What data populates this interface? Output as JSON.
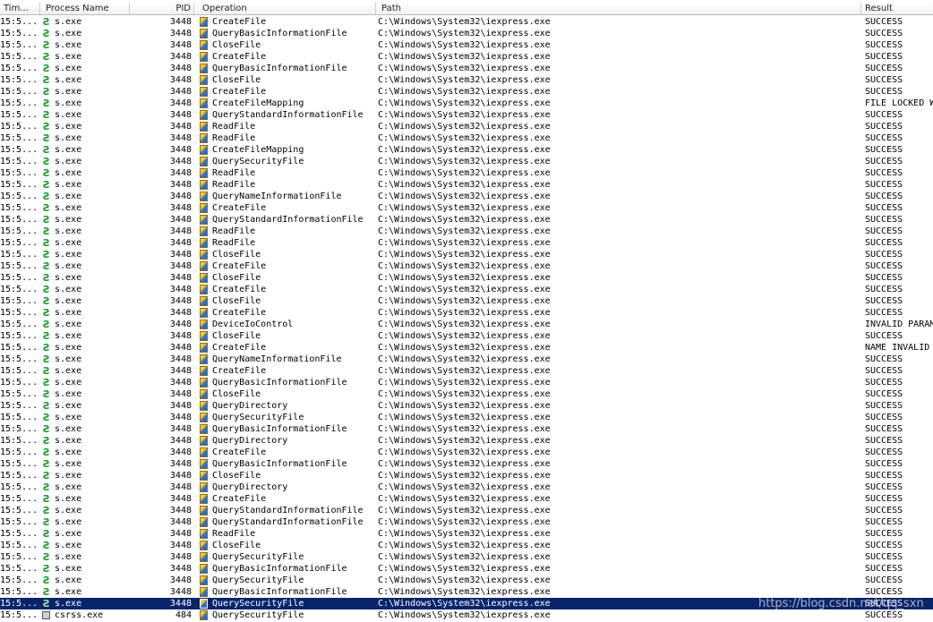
{
  "columns": {
    "time": "Tim...",
    "process": "Process Name",
    "pid": "PID",
    "operation": "Operation",
    "path": "Path",
    "result": "Result"
  },
  "rows": [
    {
      "time": "15:5...",
      "process": "s.exe",
      "pid": "3448",
      "operation": "CreateFile",
      "path": "C:\\Windows\\System32\\iexpress.exe",
      "result": "SUCCESS"
    },
    {
      "time": "15:5...",
      "process": "s.exe",
      "pid": "3448",
      "operation": "QueryBasicInformationFile",
      "path": "C:\\Windows\\System32\\iexpress.exe",
      "result": "SUCCESS"
    },
    {
      "time": "15:5...",
      "process": "s.exe",
      "pid": "3448",
      "operation": "CloseFile",
      "path": "C:\\Windows\\System32\\iexpress.exe",
      "result": "SUCCESS"
    },
    {
      "time": "15:5...",
      "process": "s.exe",
      "pid": "3448",
      "operation": "CreateFile",
      "path": "C:\\Windows\\System32\\iexpress.exe",
      "result": "SUCCESS"
    },
    {
      "time": "15:5...",
      "process": "s.exe",
      "pid": "3448",
      "operation": "QueryBasicInformationFile",
      "path": "C:\\Windows\\System32\\iexpress.exe",
      "result": "SUCCESS"
    },
    {
      "time": "15:5...",
      "process": "s.exe",
      "pid": "3448",
      "operation": "CloseFile",
      "path": "C:\\Windows\\System32\\iexpress.exe",
      "result": "SUCCESS"
    },
    {
      "time": "15:5...",
      "process": "s.exe",
      "pid": "3448",
      "operation": "CreateFile",
      "path": "C:\\Windows\\System32\\iexpress.exe",
      "result": "SUCCESS"
    },
    {
      "time": "15:5...",
      "process": "s.exe",
      "pid": "3448",
      "operation": "CreateFileMapping",
      "path": "C:\\Windows\\System32\\iexpress.exe",
      "result": "FILE LOCKED W"
    },
    {
      "time": "15:5...",
      "process": "s.exe",
      "pid": "3448",
      "operation": "QueryStandardInformationFile",
      "path": "C:\\Windows\\System32\\iexpress.exe",
      "result": "SUCCESS"
    },
    {
      "time": "15:5...",
      "process": "s.exe",
      "pid": "3448",
      "operation": "ReadFile",
      "path": "C:\\Windows\\System32\\iexpress.exe",
      "result": "SUCCESS"
    },
    {
      "time": "15:5...",
      "process": "s.exe",
      "pid": "3448",
      "operation": "ReadFile",
      "path": "C:\\Windows\\System32\\iexpress.exe",
      "result": "SUCCESS"
    },
    {
      "time": "15:5...",
      "process": "s.exe",
      "pid": "3448",
      "operation": "CreateFileMapping",
      "path": "C:\\Windows\\System32\\iexpress.exe",
      "result": "SUCCESS"
    },
    {
      "time": "15:5...",
      "process": "s.exe",
      "pid": "3448",
      "operation": "QuerySecurityFile",
      "path": "C:\\Windows\\System32\\iexpress.exe",
      "result": "SUCCESS"
    },
    {
      "time": "15:5...",
      "process": "s.exe",
      "pid": "3448",
      "operation": "ReadFile",
      "path": "C:\\Windows\\System32\\iexpress.exe",
      "result": "SUCCESS"
    },
    {
      "time": "15:5...",
      "process": "s.exe",
      "pid": "3448",
      "operation": "ReadFile",
      "path": "C:\\Windows\\System32\\iexpress.exe",
      "result": "SUCCESS"
    },
    {
      "time": "15:5...",
      "process": "s.exe",
      "pid": "3448",
      "operation": "QueryNameInformationFile",
      "path": "C:\\Windows\\System32\\iexpress.exe",
      "result": "SUCCESS"
    },
    {
      "time": "15:5...",
      "process": "s.exe",
      "pid": "3448",
      "operation": "CreateFile",
      "path": "C:\\Windows\\System32\\iexpress.exe",
      "result": "SUCCESS"
    },
    {
      "time": "15:5...",
      "process": "s.exe",
      "pid": "3448",
      "operation": "QueryStandardInformationFile",
      "path": "C:\\Windows\\System32\\iexpress.exe",
      "result": "SUCCESS"
    },
    {
      "time": "15:5...",
      "process": "s.exe",
      "pid": "3448",
      "operation": "ReadFile",
      "path": "C:\\Windows\\System32\\iexpress.exe",
      "result": "SUCCESS"
    },
    {
      "time": "15:5...",
      "process": "s.exe",
      "pid": "3448",
      "operation": "ReadFile",
      "path": "C:\\Windows\\System32\\iexpress.exe",
      "result": "SUCCESS"
    },
    {
      "time": "15:5...",
      "process": "s.exe",
      "pid": "3448",
      "operation": "CloseFile",
      "path": "C:\\Windows\\System32\\iexpress.exe",
      "result": "SUCCESS"
    },
    {
      "time": "15:5...",
      "process": "s.exe",
      "pid": "3448",
      "operation": "CreateFile",
      "path": "C:\\Windows\\System32\\iexpress.exe",
      "result": "SUCCESS"
    },
    {
      "time": "15:5...",
      "process": "s.exe",
      "pid": "3448",
      "operation": "CloseFile",
      "path": "C:\\Windows\\System32\\iexpress.exe",
      "result": "SUCCESS"
    },
    {
      "time": "15:5...",
      "process": "s.exe",
      "pid": "3448",
      "operation": "CreateFile",
      "path": "C:\\Windows\\System32\\iexpress.exe",
      "result": "SUCCESS"
    },
    {
      "time": "15:5...",
      "process": "s.exe",
      "pid": "3448",
      "operation": "CloseFile",
      "path": "C:\\Windows\\System32\\iexpress.exe",
      "result": "SUCCESS"
    },
    {
      "time": "15:5...",
      "process": "s.exe",
      "pid": "3448",
      "operation": "CreateFile",
      "path": "C:\\Windows\\System32\\iexpress.exe",
      "result": "SUCCESS"
    },
    {
      "time": "15:5...",
      "process": "s.exe",
      "pid": "3448",
      "operation": "DeviceIoControl",
      "path": "C:\\Windows\\System32\\iexpress.exe",
      "result": "INVALID PARAM"
    },
    {
      "time": "15:5...",
      "process": "s.exe",
      "pid": "3448",
      "operation": "CloseFile",
      "path": "C:\\Windows\\System32\\iexpress.exe",
      "result": "SUCCESS"
    },
    {
      "time": "15:5...",
      "process": "s.exe",
      "pid": "3448",
      "operation": "CreateFile",
      "path": "C:\\Windows\\System32\\iexpress.exe",
      "result": "NAME INVALID"
    },
    {
      "time": "15:5...",
      "process": "s.exe",
      "pid": "3448",
      "operation": "QueryNameInformationFile",
      "path": "C:\\Windows\\System32\\iexpress.exe",
      "result": "SUCCESS"
    },
    {
      "time": "15:5...",
      "process": "s.exe",
      "pid": "3448",
      "operation": "CreateFile",
      "path": "C:\\Windows\\System32\\iexpress.exe",
      "result": "SUCCESS"
    },
    {
      "time": "15:5...",
      "process": "s.exe",
      "pid": "3448",
      "operation": "QueryBasicInformationFile",
      "path": "C:\\Windows\\System32\\iexpress.exe",
      "result": "SUCCESS"
    },
    {
      "time": "15:5...",
      "process": "s.exe",
      "pid": "3448",
      "operation": "CloseFile",
      "path": "C:\\Windows\\System32\\iexpress.exe",
      "result": "SUCCESS"
    },
    {
      "time": "15:5...",
      "process": "s.exe",
      "pid": "3448",
      "operation": "QueryDirectory",
      "path": "C:\\Windows\\System32\\iexpress.exe",
      "result": "SUCCESS"
    },
    {
      "time": "15:5...",
      "process": "s.exe",
      "pid": "3448",
      "operation": "QuerySecurityFile",
      "path": "C:\\Windows\\System32\\iexpress.exe",
      "result": "SUCCESS"
    },
    {
      "time": "15:5...",
      "process": "s.exe",
      "pid": "3448",
      "operation": "QueryBasicInformationFile",
      "path": "C:\\Windows\\System32\\iexpress.exe",
      "result": "SUCCESS"
    },
    {
      "time": "15:5...",
      "process": "s.exe",
      "pid": "3448",
      "operation": "QueryDirectory",
      "path": "C:\\Windows\\System32\\iexpress.exe",
      "result": "SUCCESS"
    },
    {
      "time": "15:5...",
      "process": "s.exe",
      "pid": "3448",
      "operation": "CreateFile",
      "path": "C:\\Windows\\System32\\iexpress.exe",
      "result": "SUCCESS"
    },
    {
      "time": "15:5...",
      "process": "s.exe",
      "pid": "3448",
      "operation": "QueryBasicInformationFile",
      "path": "C:\\Windows\\System32\\iexpress.exe",
      "result": "SUCCESS"
    },
    {
      "time": "15:5...",
      "process": "s.exe",
      "pid": "3448",
      "operation": "CloseFile",
      "path": "C:\\Windows\\System32\\iexpress.exe",
      "result": "SUCCESS"
    },
    {
      "time": "15:5...",
      "process": "s.exe",
      "pid": "3448",
      "operation": "QueryDirectory",
      "path": "C:\\Windows\\System32\\iexpress.exe",
      "result": "SUCCESS"
    },
    {
      "time": "15:5...",
      "process": "s.exe",
      "pid": "3448",
      "operation": "CreateFile",
      "path": "C:\\Windows\\System32\\iexpress.exe",
      "result": "SUCCESS"
    },
    {
      "time": "15:5...",
      "process": "s.exe",
      "pid": "3448",
      "operation": "QueryStandardInformationFile",
      "path": "C:\\Windows\\System32\\iexpress.exe",
      "result": "SUCCESS"
    },
    {
      "time": "15:5...",
      "process": "s.exe",
      "pid": "3448",
      "operation": "QueryStandardInformationFile",
      "path": "C:\\Windows\\System32\\iexpress.exe",
      "result": "SUCCESS"
    },
    {
      "time": "15:5...",
      "process": "s.exe",
      "pid": "3448",
      "operation": "ReadFile",
      "path": "C:\\Windows\\System32\\iexpress.exe",
      "result": "SUCCESS"
    },
    {
      "time": "15:5...",
      "process": "s.exe",
      "pid": "3448",
      "operation": "CloseFile",
      "path": "C:\\Windows\\System32\\iexpress.exe",
      "result": "SUCCESS"
    },
    {
      "time": "15:5...",
      "process": "s.exe",
      "pid": "3448",
      "operation": "QuerySecurityFile",
      "path": "C:\\Windows\\System32\\iexpress.exe",
      "result": "SUCCESS"
    },
    {
      "time": "15:5...",
      "process": "s.exe",
      "pid": "3448",
      "operation": "QueryBasicInformationFile",
      "path": "C:\\Windows\\System32\\iexpress.exe",
      "result": "SUCCESS"
    },
    {
      "time": "15:5...",
      "process": "s.exe",
      "pid": "3448",
      "operation": "QuerySecurityFile",
      "path": "C:\\Windows\\System32\\iexpress.exe",
      "result": "SUCCESS"
    },
    {
      "time": "15:5...",
      "process": "s.exe",
      "pid": "3448",
      "operation": "QueryBasicInformationFile",
      "path": "C:\\Windows\\System32\\iexpress.exe",
      "result": "SUCCESS"
    },
    {
      "time": "15:5...",
      "process": "s.exe",
      "pid": "3448",
      "operation": "QuerySecurityFile",
      "path": "C:\\Windows\\System32\\iexpress.exe",
      "result": "SUCCESS",
      "selected": true
    },
    {
      "time": "15:5...",
      "process": "csrss.exe",
      "pid": "484",
      "operation": "QuerySecurityFile",
      "path": "C:\\Windows\\System32\\iexpress.exe",
      "result": "SUCCESS",
      "proc_icon": "window-icon"
    }
  ],
  "watermark": "https://blog.csdn.net/qq_sxn",
  "colors": {
    "selected_row_bg": "#0a246a",
    "process_icon": "#1a9a2a"
  },
  "icons": {
    "process": "green-s-process-icon",
    "operation": "file-system-icon",
    "csrss_process": "window-icon"
  }
}
